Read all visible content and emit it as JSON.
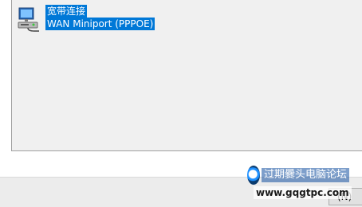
{
  "connection": {
    "name": "宽带连接",
    "device": "WAN Miniport (PPPOE)",
    "icon": "network-computer-icon"
  },
  "bottom": {
    "partial_button_label": "(N)"
  },
  "watermark": {
    "title": "过期爨头电脑论坛",
    "url": "www.gqgtpc.com"
  },
  "colors": {
    "selection": "#0078d7",
    "panel": "#f0f0f0"
  }
}
